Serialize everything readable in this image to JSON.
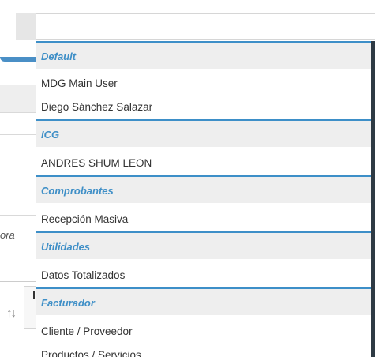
{
  "search": {
    "value": "",
    "placeholder": ""
  },
  "dropdown": {
    "groups": [
      {
        "label": "Default",
        "items": [
          "MDG Main User",
          "Diego Sánchez Salazar"
        ]
      },
      {
        "label": "ICG",
        "items": [
          "ANDRES SHUM LEON"
        ]
      },
      {
        "label": "Comprobantes",
        "items": [
          "Recepción Masiva"
        ]
      },
      {
        "label": "Utilidades",
        "items": [
          "Datos Totalizados"
        ]
      },
      {
        "label": "Facturador",
        "items": [
          "Cliente / Proveedor",
          "Productos / Servicios"
        ]
      }
    ]
  },
  "background": {
    "partial_text": "ora",
    "sort_glyph": "↑↓"
  },
  "colors": {
    "accent": "#3d8fc8",
    "header_bg": "#eeeeee",
    "scrollbar": "#2e3a44"
  }
}
